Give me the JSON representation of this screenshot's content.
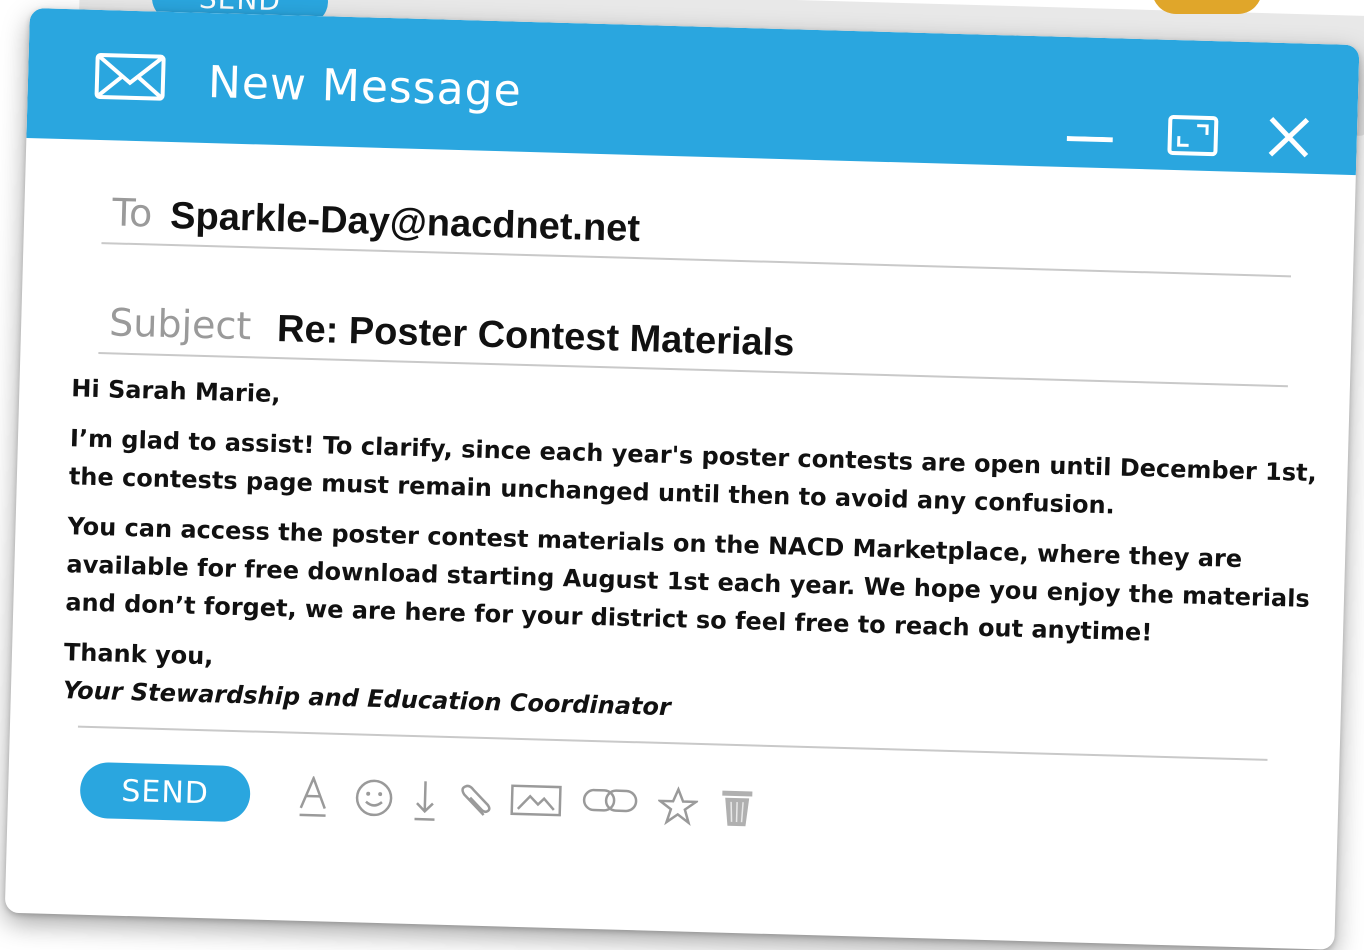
{
  "background_window": {
    "send_label": "SEND"
  },
  "window": {
    "title": "New Message",
    "accent_color": "#2aa6df"
  },
  "fields": {
    "to_label": "To",
    "to_value": "Sparkle-Day@nacdnet.net",
    "subject_label": "Subject",
    "subject_value": "Re: Poster Contest Materials"
  },
  "message": {
    "greeting": "Hi Sarah Marie,",
    "paragraph_1": "I’m glad to assist! To clarify, since each year's poster contests are open until December 1st, the contests  page must remain unchanged until then to avoid any confusion.",
    "paragraph_2": "You can access the poster contest materials on the NACD Marketplace, where they are available for free download starting August 1st each year. We hope you enjoy the materials and don’t forget, we are here for your district so feel free to reach out anytime!",
    "signoff": "Thank you,",
    "signature": "Your Stewardship and Education Coordinator"
  },
  "toolbar": {
    "send_label": "SEND",
    "icons": [
      "text-format-icon",
      "emoji-icon",
      "download-icon",
      "attach-icon",
      "image-icon",
      "link-icon",
      "star-icon",
      "trash-icon"
    ]
  }
}
